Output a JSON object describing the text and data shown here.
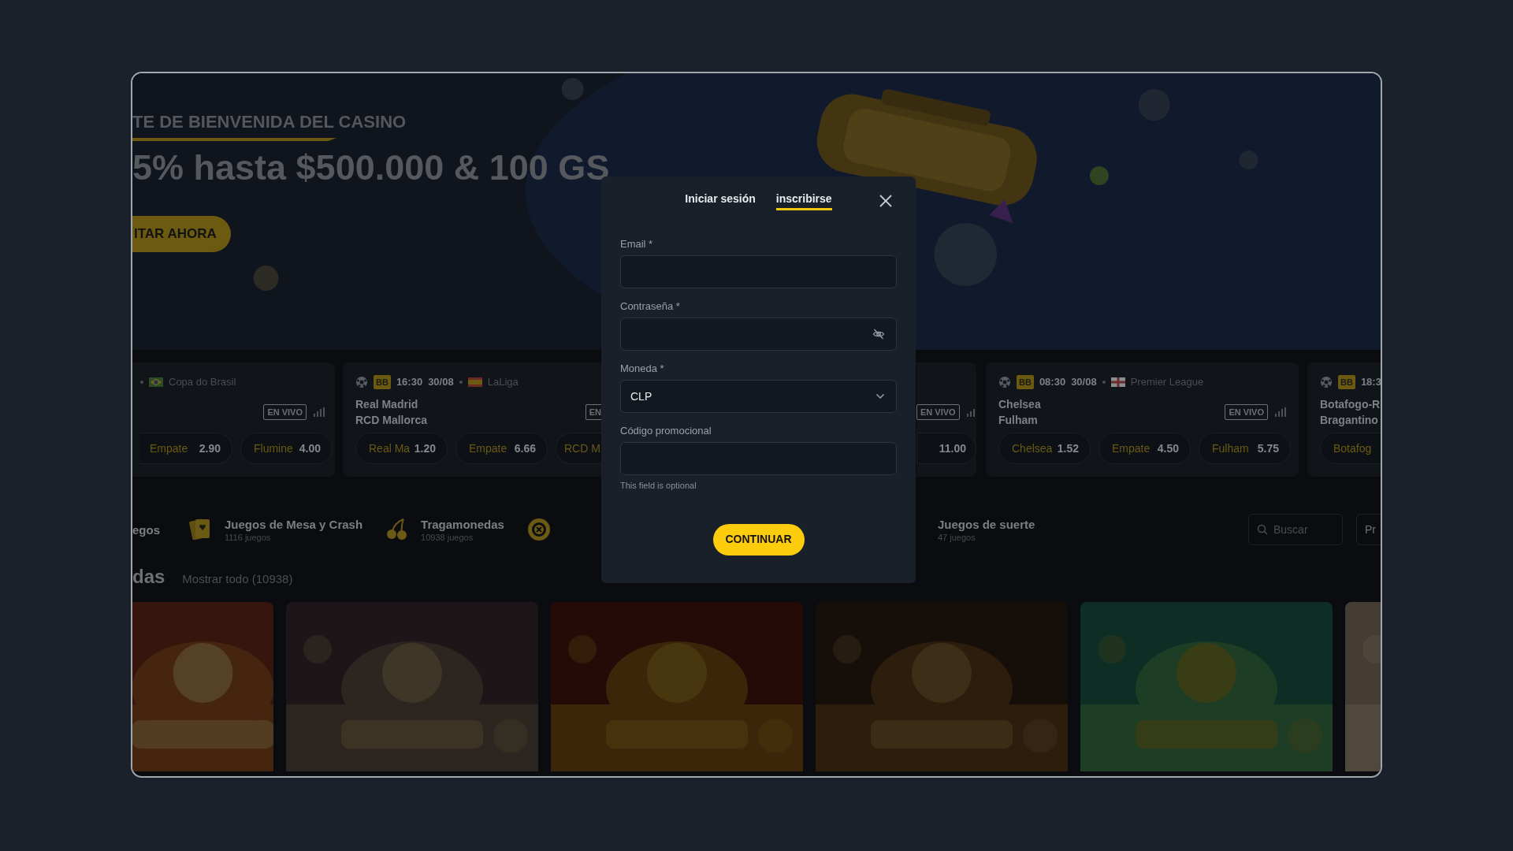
{
  "hero": {
    "eyebrow": "TE DE BIENVENIDA DEL CASINO",
    "headline": "5% hasta $500.000 & 100 GS",
    "cta": "ITAR AHORA"
  },
  "matches": [
    {
      "league": "Copa do Brasil",
      "live": "EN VIVO",
      "odds": [
        {
          "label": "Empate",
          "value": "2.90"
        },
        {
          "label": "Flumine",
          "value": "4.00"
        }
      ]
    },
    {
      "sport": "BB",
      "time": "16:30",
      "date": "30/08",
      "league": "LaLiga",
      "teams": [
        "Real Madrid",
        "RCD Mallorca"
      ],
      "live": "EN",
      "odds": [
        {
          "label": "Real Ma",
          "value": "1.20"
        },
        {
          "label": "Empate",
          "value": "6.66"
        },
        {
          "label": "RCD M"
        }
      ]
    },
    {
      "live": "EN VIVO",
      "odds": [
        {
          "value": "11.00"
        }
      ]
    },
    {
      "sport": "BB",
      "time": "08:30",
      "date": "30/08",
      "league": "Premier League",
      "teams": [
        "Chelsea",
        "Fulham"
      ],
      "live": "EN VIVO",
      "odds": [
        {
          "label": "Chelsea",
          "value": "1.52"
        },
        {
          "label": "Empate",
          "value": "4.50"
        },
        {
          "label": "Fulham",
          "value": "5.75"
        }
      ]
    },
    {
      "sport": "BB",
      "time": "18:3",
      "teams": [
        "Botafogo-R",
        "Bragantino"
      ],
      "odds": [
        {
          "label": "Botafog"
        }
      ]
    }
  ],
  "categories": [
    {
      "kind": "link",
      "label": "egos"
    },
    {
      "kind": "link",
      "label": "Juegos de Mesa y Crash",
      "count": "1116 juegos"
    },
    {
      "kind": "link",
      "label": "Tragamonedas",
      "count": "10938 juegos"
    },
    {
      "kind": "icon"
    },
    {
      "kind": "link",
      "label": "Juegos de suerte",
      "count": "47 juegos"
    }
  ],
  "search": {
    "placeholder": "Buscar"
  },
  "filter_button": "Pr",
  "section": {
    "title": "das",
    "link": "Mostrar todo (10938)"
  },
  "modal": {
    "tabs": [
      {
        "label": "Iniciar sesión",
        "selected": false
      },
      {
        "label": "inscribirse",
        "selected": true
      }
    ],
    "fields": [
      {
        "kind": "text",
        "label": "Email *"
      },
      {
        "kind": "password",
        "label": "Contraseña *"
      },
      {
        "kind": "select",
        "label": "Moneda *",
        "value": "CLP"
      },
      {
        "kind": "text",
        "label": "Código promocional",
        "hint": "This field is optional"
      }
    ],
    "submit": "CONTINUAR"
  }
}
